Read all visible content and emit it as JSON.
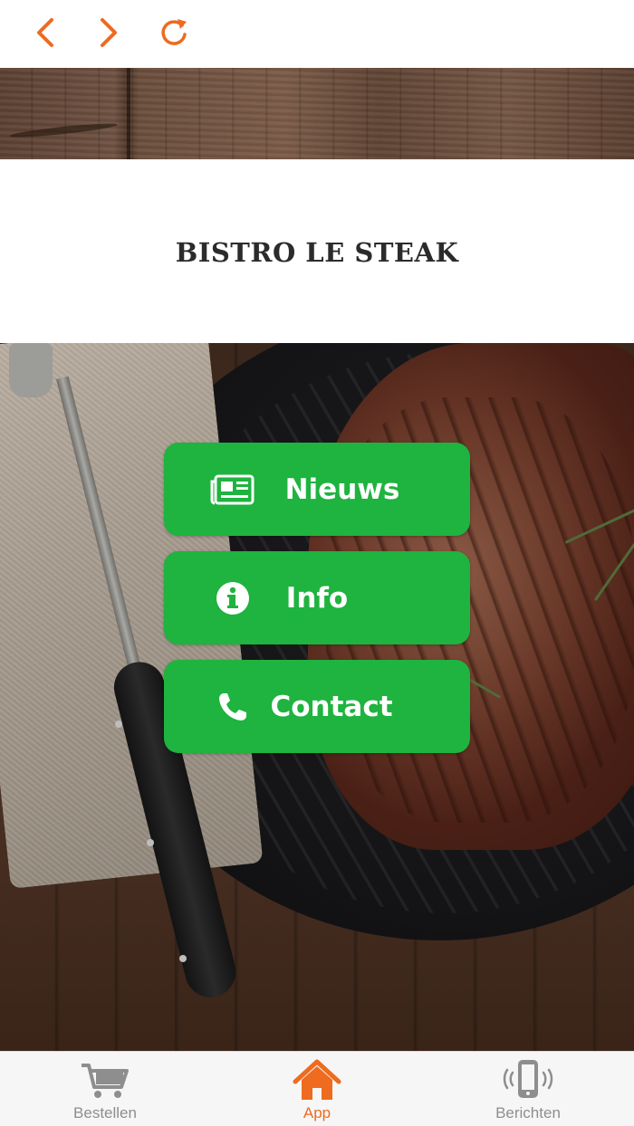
{
  "nav": {
    "back_icon": "chevron-left-icon",
    "forward_icon": "chevron-right-icon",
    "reload_icon": "reload-icon",
    "accent": "#ee6b1f"
  },
  "header": {
    "title": "BISTRO LE STEAK"
  },
  "menu": {
    "button_color": "#1fb33f",
    "items": [
      {
        "label": "Nieuws",
        "icon": "newspaper-icon"
      },
      {
        "label": "Info",
        "icon": "info-icon"
      },
      {
        "label": "Contact",
        "icon": "phone-icon"
      }
    ]
  },
  "tabbar": {
    "active": "App",
    "active_color": "#ee6b1f",
    "inactive_color": "#8e8e8e",
    "items": [
      {
        "label": "Bestellen",
        "icon": "cart-icon"
      },
      {
        "label": "App",
        "icon": "home-icon"
      },
      {
        "label": "Berichten",
        "icon": "phone-vibrate-icon"
      }
    ]
  }
}
